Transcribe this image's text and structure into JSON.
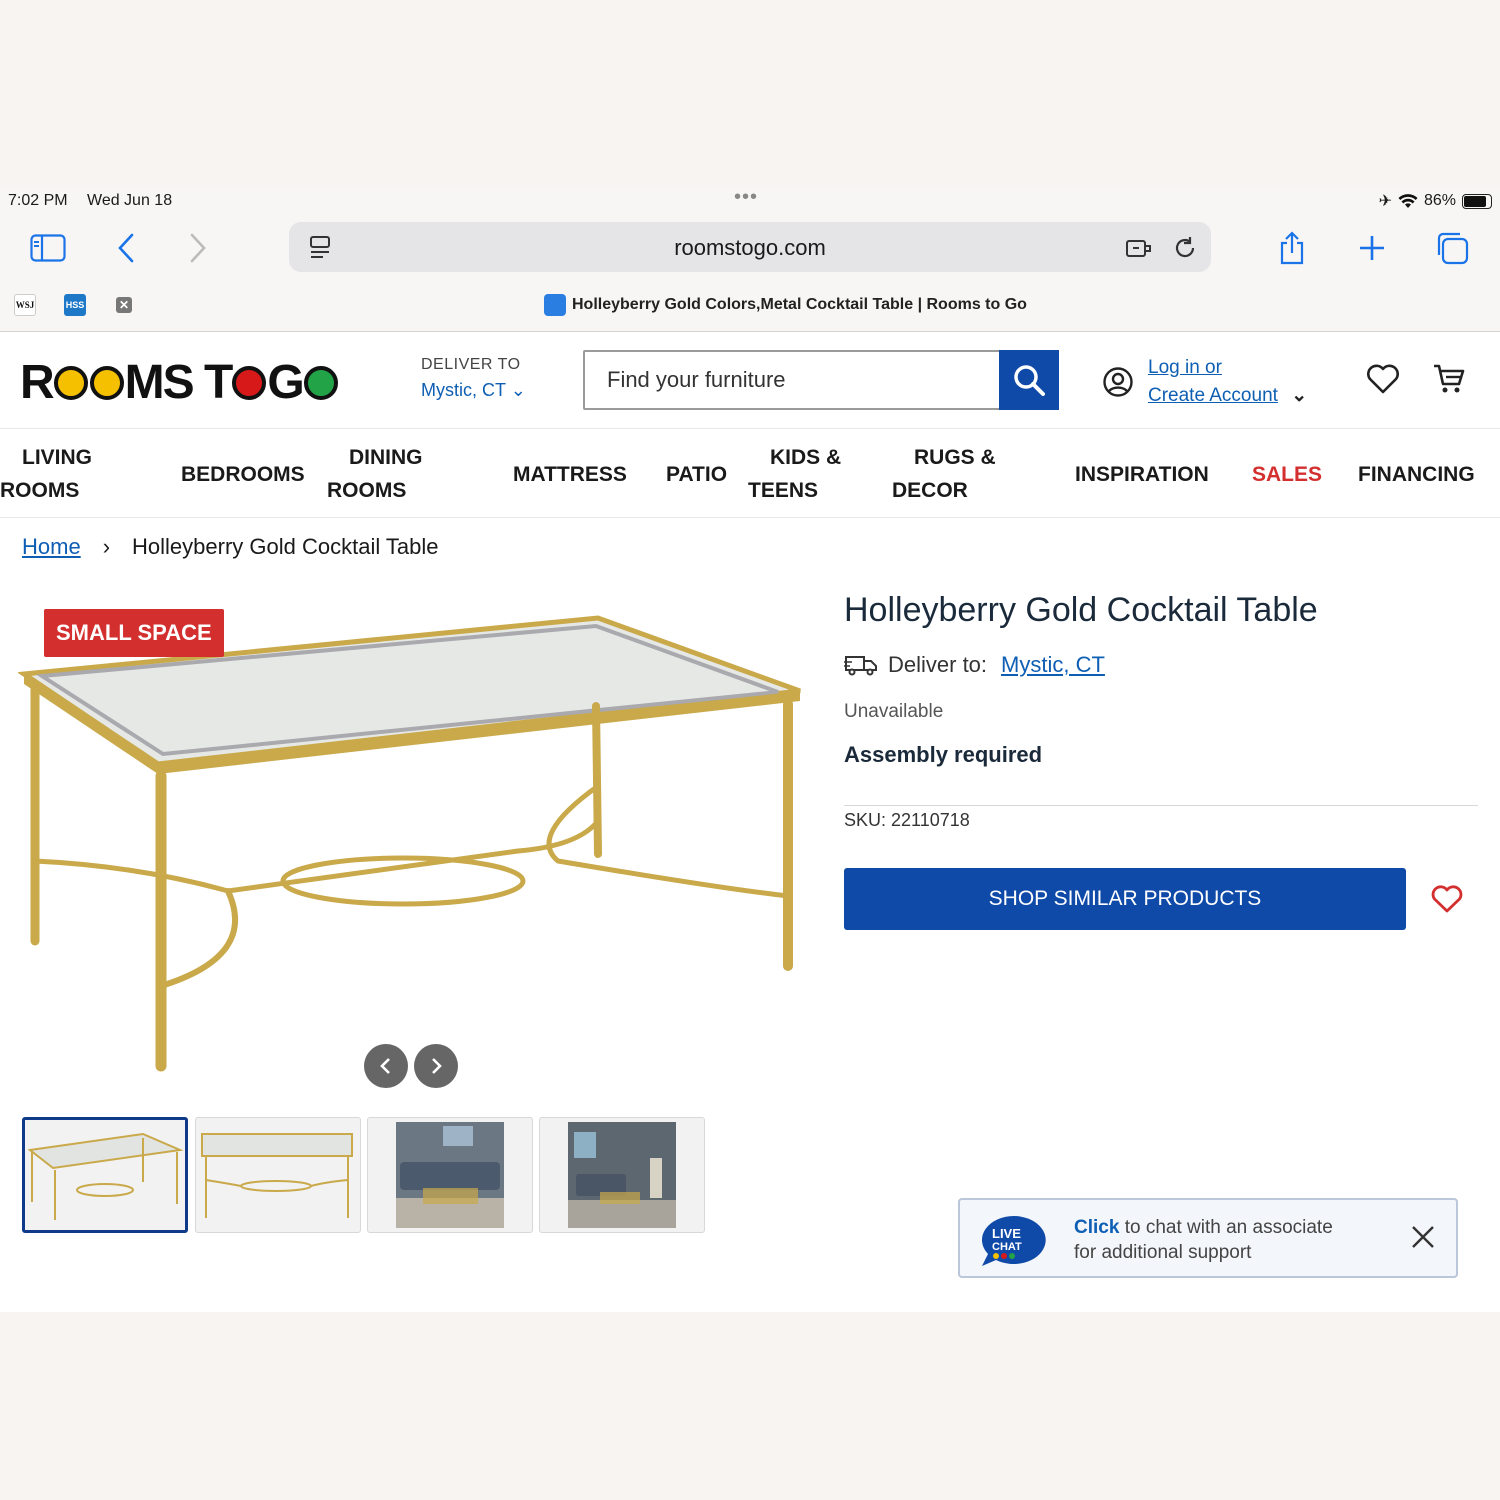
{
  "status": {
    "time": "7:02 PM",
    "date": "Wed Jun 18",
    "battery": "86%"
  },
  "browser": {
    "url": "roomstogo.com",
    "pinned_tabs": [
      "WSJ",
      "HSS"
    ],
    "tab_title": "Holleyberry Gold Colors,Metal Cocktail Table | Rooms to Go"
  },
  "header": {
    "logo": {
      "part1": "R",
      "part2": "MS T",
      "part3": " G"
    },
    "deliver_label": "DELIVER TO",
    "deliver_location": "Mystic, CT",
    "search_placeholder": "Find your furniture",
    "login_line1": "Log in or",
    "login_line2": "Create Account"
  },
  "nav": {
    "items": [
      {
        "line1": "LIVING",
        "line2": "ROOMS"
      },
      {
        "line1": "BEDROOMS",
        "line2": ""
      },
      {
        "line1": "DINING",
        "line2": "ROOMS"
      },
      {
        "line1": "MATTRESS",
        "line2": ""
      },
      {
        "line1": "PATIO",
        "line2": ""
      },
      {
        "line1": "KIDS &",
        "line2": "TEENS"
      },
      {
        "line1": "RUGS &",
        "line2": "DECOR"
      },
      {
        "line1": "INSPIRATION",
        "line2": ""
      },
      {
        "line1": "SALES",
        "line2": ""
      },
      {
        "line1": "FINANCING",
        "line2": ""
      }
    ]
  },
  "breadcrumb": {
    "home": "Home",
    "current": "Holleyberry Gold Cocktail Table"
  },
  "product": {
    "badge": "SMALL SPACE",
    "title": "Holleyberry Gold Cocktail Table",
    "deliver_label": "Deliver to:",
    "deliver_city": "Mystic, CT",
    "availability": "Unavailable",
    "assembly": "Assembly required",
    "sku": "SKU: 22110718",
    "shop_button": "SHOP SIMILAR PRODUCTS",
    "thumbnail_count": 4,
    "selected_thumbnail": 1
  },
  "chat": {
    "icon_text_1": "LIVE",
    "icon_text_2": "CHAT",
    "click": "Click",
    "line1_rest": " to chat with an associate",
    "line2": "for additional support"
  },
  "colors": {
    "brand_blue": "#0f4aa8",
    "link_blue": "#0e5fb4",
    "sale_red": "#d42f2f",
    "gold": "#c9a94a"
  }
}
